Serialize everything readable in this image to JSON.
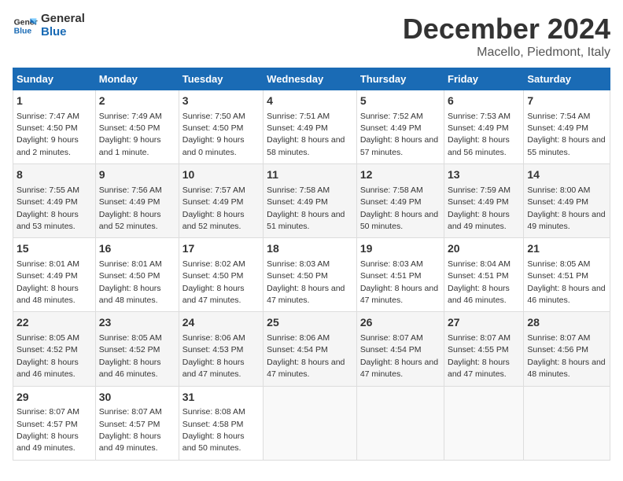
{
  "logo": {
    "line1": "General",
    "line2": "Blue"
  },
  "title": "December 2024",
  "subtitle": "Macello, Piedmont, Italy",
  "days_of_week": [
    "Sunday",
    "Monday",
    "Tuesday",
    "Wednesday",
    "Thursday",
    "Friday",
    "Saturday"
  ],
  "weeks": [
    [
      {
        "day": "1",
        "sunrise": "7:47 AM",
        "sunset": "4:50 PM",
        "daylight": "9 hours and 2 minutes."
      },
      {
        "day": "2",
        "sunrise": "7:49 AM",
        "sunset": "4:50 PM",
        "daylight": "9 hours and 1 minute."
      },
      {
        "day": "3",
        "sunrise": "7:50 AM",
        "sunset": "4:50 PM",
        "daylight": "9 hours and 0 minutes."
      },
      {
        "day": "4",
        "sunrise": "7:51 AM",
        "sunset": "4:49 PM",
        "daylight": "8 hours and 58 minutes."
      },
      {
        "day": "5",
        "sunrise": "7:52 AM",
        "sunset": "4:49 PM",
        "daylight": "8 hours and 57 minutes."
      },
      {
        "day": "6",
        "sunrise": "7:53 AM",
        "sunset": "4:49 PM",
        "daylight": "8 hours and 56 minutes."
      },
      {
        "day": "7",
        "sunrise": "7:54 AM",
        "sunset": "4:49 PM",
        "daylight": "8 hours and 55 minutes."
      }
    ],
    [
      {
        "day": "8",
        "sunrise": "7:55 AM",
        "sunset": "4:49 PM",
        "daylight": "8 hours and 53 minutes."
      },
      {
        "day": "9",
        "sunrise": "7:56 AM",
        "sunset": "4:49 PM",
        "daylight": "8 hours and 52 minutes."
      },
      {
        "day": "10",
        "sunrise": "7:57 AM",
        "sunset": "4:49 PM",
        "daylight": "8 hours and 52 minutes."
      },
      {
        "day": "11",
        "sunrise": "7:58 AM",
        "sunset": "4:49 PM",
        "daylight": "8 hours and 51 minutes."
      },
      {
        "day": "12",
        "sunrise": "7:58 AM",
        "sunset": "4:49 PM",
        "daylight": "8 hours and 50 minutes."
      },
      {
        "day": "13",
        "sunrise": "7:59 AM",
        "sunset": "4:49 PM",
        "daylight": "8 hours and 49 minutes."
      },
      {
        "day": "14",
        "sunrise": "8:00 AM",
        "sunset": "4:49 PM",
        "daylight": "8 hours and 49 minutes."
      }
    ],
    [
      {
        "day": "15",
        "sunrise": "8:01 AM",
        "sunset": "4:49 PM",
        "daylight": "8 hours and 48 minutes."
      },
      {
        "day": "16",
        "sunrise": "8:01 AM",
        "sunset": "4:50 PM",
        "daylight": "8 hours and 48 minutes."
      },
      {
        "day": "17",
        "sunrise": "8:02 AM",
        "sunset": "4:50 PM",
        "daylight": "8 hours and 47 minutes."
      },
      {
        "day": "18",
        "sunrise": "8:03 AM",
        "sunset": "4:50 PM",
        "daylight": "8 hours and 47 minutes."
      },
      {
        "day": "19",
        "sunrise": "8:03 AM",
        "sunset": "4:51 PM",
        "daylight": "8 hours and 47 minutes."
      },
      {
        "day": "20",
        "sunrise": "8:04 AM",
        "sunset": "4:51 PM",
        "daylight": "8 hours and 46 minutes."
      },
      {
        "day": "21",
        "sunrise": "8:05 AM",
        "sunset": "4:51 PM",
        "daylight": "8 hours and 46 minutes."
      }
    ],
    [
      {
        "day": "22",
        "sunrise": "8:05 AM",
        "sunset": "4:52 PM",
        "daylight": "8 hours and 46 minutes."
      },
      {
        "day": "23",
        "sunrise": "8:05 AM",
        "sunset": "4:52 PM",
        "daylight": "8 hours and 46 minutes."
      },
      {
        "day": "24",
        "sunrise": "8:06 AM",
        "sunset": "4:53 PM",
        "daylight": "8 hours and 47 minutes."
      },
      {
        "day": "25",
        "sunrise": "8:06 AM",
        "sunset": "4:54 PM",
        "daylight": "8 hours and 47 minutes."
      },
      {
        "day": "26",
        "sunrise": "8:07 AM",
        "sunset": "4:54 PM",
        "daylight": "8 hours and 47 minutes."
      },
      {
        "day": "27",
        "sunrise": "8:07 AM",
        "sunset": "4:55 PM",
        "daylight": "8 hours and 47 minutes."
      },
      {
        "day": "28",
        "sunrise": "8:07 AM",
        "sunset": "4:56 PM",
        "daylight": "8 hours and 48 minutes."
      }
    ],
    [
      {
        "day": "29",
        "sunrise": "8:07 AM",
        "sunset": "4:57 PM",
        "daylight": "8 hours and 49 minutes."
      },
      {
        "day": "30",
        "sunrise": "8:07 AM",
        "sunset": "4:57 PM",
        "daylight": "8 hours and 49 minutes."
      },
      {
        "day": "31",
        "sunrise": "8:08 AM",
        "sunset": "4:58 PM",
        "daylight": "8 hours and 50 minutes."
      },
      null,
      null,
      null,
      null
    ]
  ],
  "labels": {
    "sunrise_prefix": "Sunrise: ",
    "sunset_prefix": "Sunset: ",
    "daylight_prefix": "Daylight: "
  }
}
